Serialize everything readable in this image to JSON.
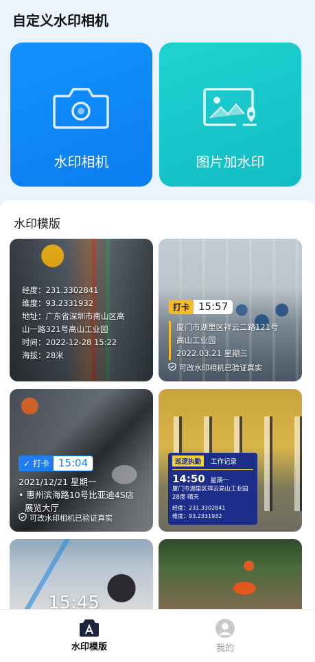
{
  "app": {
    "title": "自定义水印相机"
  },
  "actions": {
    "camera_label": "水印相机",
    "image_label": "图片加水印"
  },
  "templates": {
    "section_title": "水印模版",
    "t1": {
      "longitude": "经度：231.3302841",
      "latitude": "维度：93.2331932",
      "address_line1": "地址：广东省深圳市南山区高",
      "address_line2": "山一路321号高山工业园",
      "time": "时间：2022-12-28 15:22",
      "altitude": "海拔：28米"
    },
    "t2": {
      "tag": "打卡",
      "time": "15:57",
      "address_line1": "厦门市湖里区祥云二路121号",
      "address_line2": "高山工业园",
      "date": "2022.03.21 星期三",
      "verify": "可改水印相机已验证真实"
    },
    "t3": {
      "tag": "打卡",
      "time": "15:04",
      "date": "2021/12/21  星期一",
      "address_line1": "惠州滨海路10号比亚迪4S店",
      "address_line2": "展览大厅",
      "verify": "可改水印相机已验证真实"
    },
    "t4": {
      "badge": "巡逻执勤",
      "record": "工作记录",
      "time": "14:50",
      "weekday": "星期一",
      "address": "厦门市湖里区祥云高山工业园",
      "weather": "28度 晴天",
      "longitude": "经度：231.3302841",
      "latitude": "维度：93.2331932"
    },
    "t5": {
      "time": "15:45"
    }
  },
  "tabs": [
    {
      "label": "水印模版",
      "active": true
    },
    {
      "label": "我的",
      "active": false
    }
  ],
  "colors": {
    "accent_blue": "#0a84f5",
    "accent_teal": "#18c6c9",
    "punch_yellow": "#f7bb2a",
    "navy": "#1d2d8a"
  }
}
